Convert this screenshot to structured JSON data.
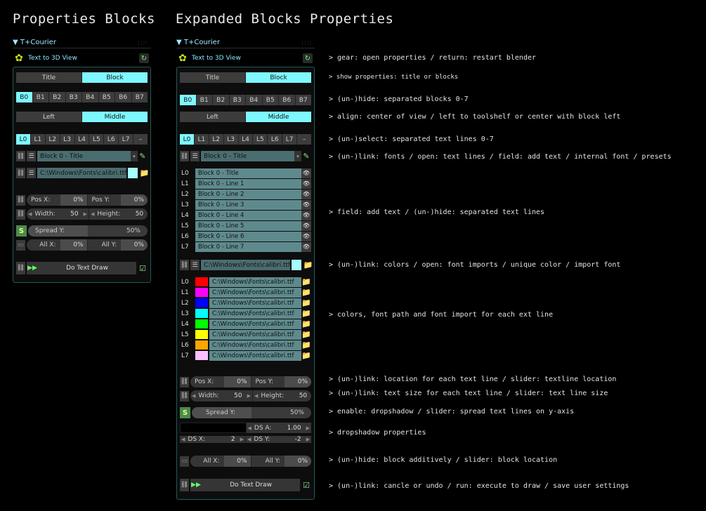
{
  "headings": {
    "left": "Properties Blocks",
    "right": "Expanded Blocks Properties"
  },
  "panel": {
    "header": "▼ T+Courier",
    "text_to_3d": "Text to 3D View",
    "title_toggle": [
      "Title",
      "Block"
    ],
    "blocks": [
      "B0",
      "B1",
      "B2",
      "B3",
      "B4",
      "B5",
      "B6",
      "B7"
    ],
    "align": [
      "Left",
      "Middle"
    ],
    "lines": [
      "L0",
      "L1",
      "L2",
      "L3",
      "L4",
      "L5",
      "L6",
      "L7",
      "–"
    ],
    "block_title_field": "Block 0 - Title",
    "font_path": "C:\\Windows\\Fonts\\calibri.ttf",
    "pos_x_label": "Pos X:",
    "pos_x_value": "0%",
    "pos_y_label": "Pos Y:",
    "pos_y_value": "0%",
    "width_label": "Width:",
    "width_value": "50",
    "height_label": "Height:",
    "height_value": "50",
    "spread_label": "Spread Y:",
    "spread_value": "50%",
    "spread_fraction": 0.5,
    "all_x_label": "All X:",
    "all_x_value": "0%",
    "all_y_label": "All Y:",
    "all_y_value": "0%",
    "do_text_draw": "Do Text Draw",
    "ds_a_label": "DS A:",
    "ds_a_value": "1.00",
    "ds_x_label": "DS X:",
    "ds_x_value": "2",
    "ds_y_label": "DS Y:",
    "ds_y_value": "-2",
    "accent_color": "#7ef8ff"
  },
  "expanded_lines": {
    "labels": [
      "L0",
      "L1",
      "L2",
      "L3",
      "L4",
      "L5",
      "L6",
      "L7"
    ],
    "texts": [
      "Block 0 - Title",
      "Block 0 - Line 1",
      "Block 0 - Line 2",
      "Block 0 - Line 3",
      "Block 0 - Line 4",
      "Block 0 - Line 5",
      "Block 0 - Line 6",
      "Block 0 - Line 7"
    ]
  },
  "line_colors": [
    "#ff0000",
    "#ff00ff",
    "#0000ff",
    "#00ffff",
    "#00ff00",
    "#ffff00",
    "#ffa500",
    "#ffc0ff"
  ],
  "descriptions": [
    "> gear: open properties / return: restart blender",
    "> show properties: title or blocks",
    "> (un-)hide: separated blocks 0-7",
    "> align: center of view / left to toolshelf or center with block left",
    "> (un-)select: separated text lines 0-7",
    "> (un-)link: fonts / open: text lines / field: add text / internal font / presets",
    "> field: add text / (un-)hide: separated text lines",
    "> (un-)link: colors / open: font imports / unique color / import font",
    "> colors, font path and font import for each ext line",
    "> (un-)link: location for each text line / slider: textline location",
    "> (un-)link: text size for each text line / slider: text line size",
    "> enable: dropshadow / slider: spread text lines on y-axis",
    "> dropshadow properties",
    "> (un-)hide: block additively / slider: block location",
    "> (un-)link: cancle or undo / run: execute to draw / save user settings"
  ]
}
